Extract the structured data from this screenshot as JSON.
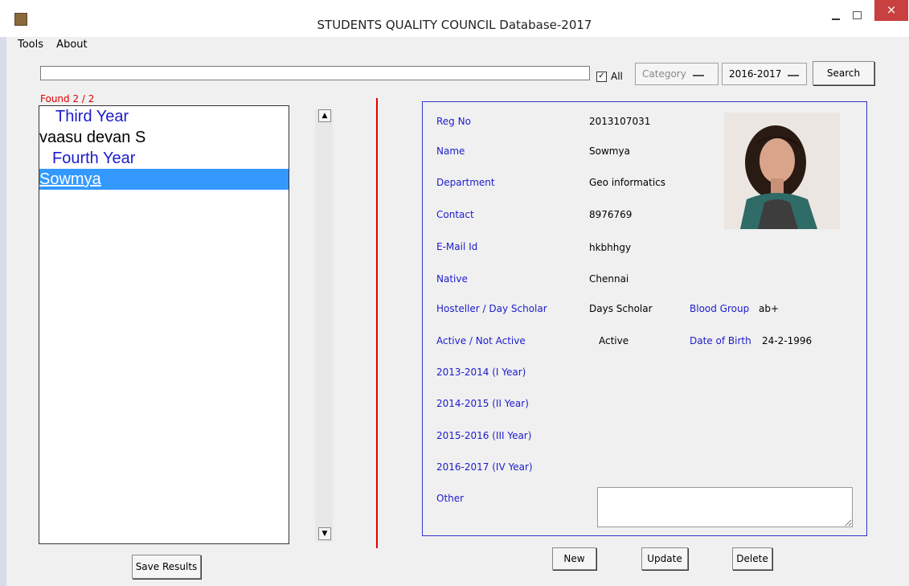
{
  "window": {
    "title": "STUDENTS QUALITY COUNCIL Database-2017",
    "close_glyph": "×"
  },
  "menu": {
    "items": [
      "Tools",
      "About"
    ]
  },
  "toolbar": {
    "search_value": "",
    "all_label": "All",
    "all_checked_glyph": "✓",
    "category_value": "Category",
    "year_value": "2016-2017",
    "search_button": "Search"
  },
  "results": {
    "found_label": "Found 2 / 2",
    "items": [
      {
        "text": "Third Year",
        "kind": "group"
      },
      {
        "text": "vaasu devan S",
        "kind": "student"
      },
      {
        "text": "Fourth Year",
        "kind": "group"
      },
      {
        "text": "Sowmya",
        "kind": "student-selected"
      }
    ],
    "save_button": "Save Results",
    "scroll_up_glyph": "▲",
    "scroll_down_glyph": "▼"
  },
  "details": {
    "reg_no_label": "Reg No",
    "reg_no": "2013107031",
    "name_label": "Name",
    "name": "Sowmya",
    "department_label": "Department",
    "department": "Geo informatics",
    "contact_label": "Contact",
    "contact": "8976769",
    "email_label": "E-Mail Id",
    "email": "hkbhhgy",
    "native_label": "Native",
    "native": "Chennai",
    "hosteller_label": "Hosteller / Day Scholar",
    "hosteller": "Days Scholar",
    "blood_group_label": "Blood Group",
    "blood_group": "ab+",
    "active_label": "Active / Not Active",
    "active": "Active",
    "dob_label": "Date of Birth",
    "dob": "24-2-1996",
    "year1_label": "2013-2014 (I Year)",
    "year2_label": "2014-2015 (II Year)",
    "year3_label": "2015-2016 (III Year)",
    "year4_label": "2016-2017 (IV Year)",
    "other_label": "Other",
    "other_value": ""
  },
  "actions": {
    "new_button": "New",
    "update_button": "Update",
    "delete_button": "Delete"
  },
  "colors": {
    "label_blue": "#1c1ccc",
    "found_red": "#e00000",
    "selection_blue": "#3399ff",
    "divider_red": "#e00000",
    "close_red": "#c84040"
  }
}
